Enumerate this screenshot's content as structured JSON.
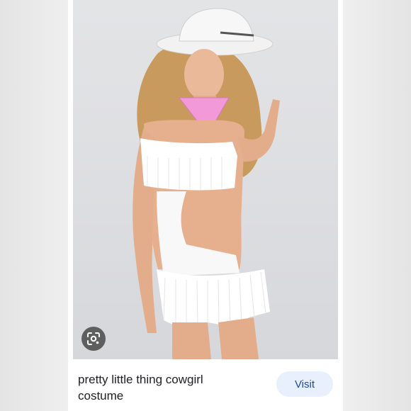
{
  "result": {
    "caption": "pretty little thing cowgirl costume",
    "visit_label": "Visit"
  },
  "icons": {
    "lens": "google-lens-icon"
  },
  "colors": {
    "visit_bg": "#e8f0fe",
    "visit_text": "#1a4a9c",
    "bandana": "#f29ad8"
  }
}
